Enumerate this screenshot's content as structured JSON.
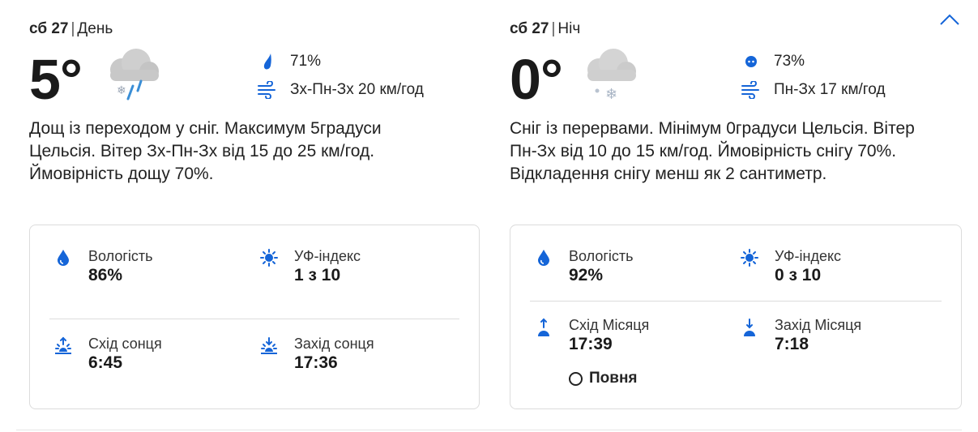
{
  "colors": {
    "accent": "#1565d8",
    "text": "#252525",
    "border": "#dcdcdc"
  },
  "collapse": {
    "icon": "chevron-up-icon"
  },
  "day": {
    "date": "сб 27",
    "period": "День",
    "temperature": "5°",
    "weather_icon": "rain-snow-icon",
    "precip_icon": "raindrop-icon",
    "precip": "71%",
    "wind_icon": "wind-icon",
    "wind": "Зх-Пн-Зх 20 км/год",
    "summary": "Дощ із переходом у сніг. Максимум 5градуси Цельсія. Вітер Зх-Пн-Зх від 15 до 25 км/год. Ймовірність дощу 70%.",
    "humidity_label": "Вологість",
    "humidity": "86%",
    "uv_label": "УФ-індекс",
    "uv": "1 з 10",
    "rise_label": "Схід сонця",
    "rise": "6:45",
    "set_label": "Захід сонця",
    "set": "17:36"
  },
  "night": {
    "date": "сб 27",
    "period": "Ніч",
    "temperature": "0°",
    "weather_icon": "snow-icon",
    "precip_icon": "snow-dot-icon",
    "precip": "73%",
    "wind_icon": "wind-icon",
    "wind": "Пн-Зх 17 км/год",
    "summary": "Сніг із перервами. Мінімум 0градуси Цельсія. Вітер Пн-Зх від 10 до 15 км/год. Ймовірність снігу 70%. Відкладення снігу менш як 2 сантиметр.",
    "humidity_label": "Вологість",
    "humidity": "92%",
    "uv_label": "УФ-індекс",
    "uv": "0 з 10",
    "rise_label": "Схід Місяця",
    "rise": "17:39",
    "set_label": "Захід Місяця",
    "set": "7:18",
    "moon_phase": "Повня"
  }
}
